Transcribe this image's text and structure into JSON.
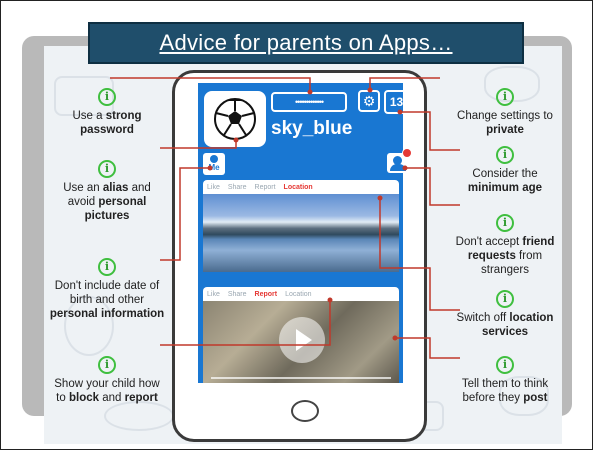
{
  "title": "Advice for parents on Apps…",
  "profile": {
    "username": "sky_blue",
    "password_dots": "•••••••••••••",
    "age_badge": "13+",
    "me_label": "Me"
  },
  "post_actions": [
    "Like",
    "Share",
    "Report",
    "Location"
  ],
  "tips": [
    {
      "pre": "Use a ",
      "bold": "strong password",
      "post": ""
    },
    {
      "pre": "Use an ",
      "bold": "alias",
      "mid": " and avoid ",
      "bold2": "personal pictures"
    },
    {
      "pre": "Don't include date of birth and other ",
      "bold": "personal information",
      "post": ""
    },
    {
      "pre": "Show your child how to ",
      "bold": "block",
      "mid": " and ",
      "bold2": "report"
    },
    {
      "pre": "Change settings to ",
      "bold": "private",
      "post": ""
    },
    {
      "pre": "Consider the ",
      "bold": "minimum age",
      "post": ""
    },
    {
      "pre": "Don't accept ",
      "bold": "friend requests",
      "post": " from strangers"
    },
    {
      "pre": "Switch off ",
      "bold": "location services",
      "post": ""
    },
    {
      "pre": "Tell them to think before they ",
      "bold": "post",
      "post": ""
    }
  ],
  "colors": {
    "title_bar": "#1f4e6b",
    "screen": "#1977d2",
    "info_icon": "#3fbf3f",
    "connector": "#c0392b"
  }
}
